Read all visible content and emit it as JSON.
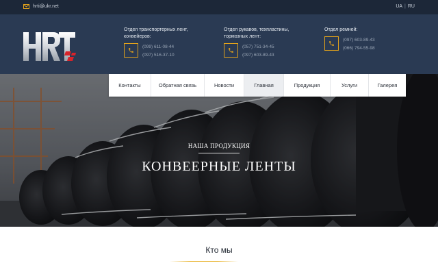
{
  "topbar": {
    "email": "hrti@ukr.net",
    "lang_ua": "UA",
    "lang_sep": "|",
    "lang_ru": "RU"
  },
  "logo": {
    "text": "HRT"
  },
  "contacts": [
    {
      "title": "Отдел транспортерных лент, конвейеров:",
      "phones": [
        "(099) 611-08-44",
        "(097) 516-37-10"
      ]
    },
    {
      "title": "Отдел рукавов, техпластины, тормозных лент:",
      "phones": [
        "(057) 751-34-45",
        "(097) 603-89-43"
      ]
    },
    {
      "title": "Отдел ремней:",
      "phones": [
        "(097) 603-89-43",
        "(066) 794-55-98"
      ]
    }
  ],
  "nav": {
    "items": [
      "Контакты",
      "Обратная связь",
      "Новости",
      "Главная",
      "Продукция",
      "Услуги",
      "Галерея"
    ],
    "active": "Главная"
  },
  "hero": {
    "subtitle": "НАША ПРОДУКЦИЯ",
    "title": "КОНВЕЕРНЫЕ ЛЕНТЫ"
  },
  "about": {
    "title": "Кто мы"
  },
  "colors": {
    "topbar": "#1c2738",
    "header": "#2a3a53",
    "accent": "#e2a21b",
    "logo_red": "#d8232a"
  }
}
